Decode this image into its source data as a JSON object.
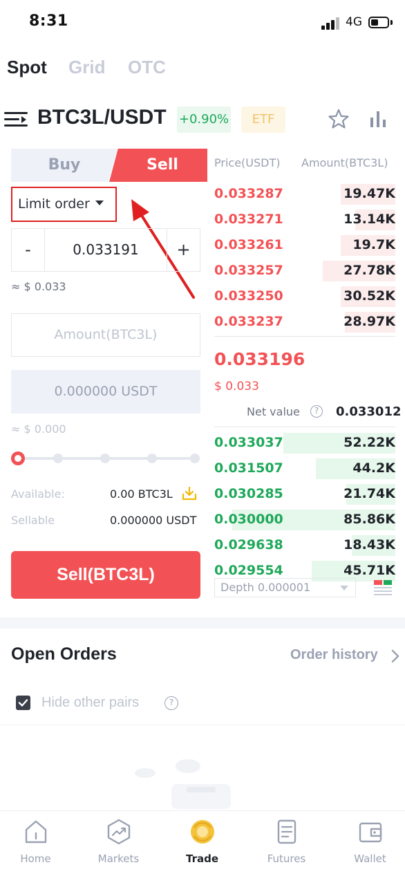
{
  "status_bar": {
    "time": "8:31",
    "network": "4G"
  },
  "mode_tabs": [
    {
      "label": "Spot",
      "active": true
    },
    {
      "label": "Grid",
      "active": false
    },
    {
      "label": "OTC",
      "active": false
    }
  ],
  "pair": {
    "symbol": "BTC3L/USDT",
    "change": "+0.90%",
    "tag": "ETF"
  },
  "order_form": {
    "buy_label": "Buy",
    "sell_label": "Sell",
    "order_type": "Limit order",
    "price_minus": "-",
    "price_value": "0.033191",
    "price_plus": "+",
    "price_approx": "≈ $ 0.033",
    "amount_placeholder": "Amount(BTC3L)",
    "total_value": "0.000000 USDT",
    "total_approx": "≈ $ 0.000",
    "slider_percent": 0,
    "available_label": "Available:",
    "available_value": "0.00 BTC3L",
    "sellable_label": "Sellable",
    "sellable_value": "0.000000 USDT",
    "submit_label": "Sell(BTC3L)"
  },
  "order_book": {
    "price_header": "Price(USDT)",
    "amount_header": "Amount(BTC3L)",
    "asks": [
      {
        "price": "0.033287",
        "amount": "19.47K",
        "depth": 0.3
      },
      {
        "price": "0.033271",
        "amount": "13.14K",
        "depth": 0.22
      },
      {
        "price": "0.033261",
        "amount": "19.7K",
        "depth": 0.3
      },
      {
        "price": "0.033257",
        "amount": "27.78K",
        "depth": 0.4
      },
      {
        "price": "0.033250",
        "amount": "30.52K",
        "depth": 0.3
      },
      {
        "price": "0.033237",
        "amount": "28.97K",
        "depth": 0.28
      }
    ],
    "last_price": "0.033196",
    "last_price_usd": "$ 0.033",
    "net_value_label": "Net value",
    "net_value": "0.033012",
    "bids": [
      {
        "price": "0.033037",
        "amount": "52.22K",
        "depth": 0.62
      },
      {
        "price": "0.031507",
        "amount": "44.2K",
        "depth": 0.44
      },
      {
        "price": "0.030285",
        "amount": "21.74K",
        "depth": 0.27
      },
      {
        "price": "0.030000",
        "amount": "85.86K",
        "depth": 0.9
      },
      {
        "price": "0.029638",
        "amount": "18.43K",
        "depth": 0.24
      },
      {
        "price": "0.029554",
        "amount": "45.71K",
        "depth": 0.46
      }
    ],
    "depth_select": "Depth 0.000001"
  },
  "open_orders": {
    "title": "Open Orders",
    "history_link": "Order history",
    "hide_pairs_label": "Hide other pairs",
    "hide_pairs_checked": true
  },
  "bottom_nav": [
    {
      "label": "Home",
      "icon": "home-icon",
      "active": false
    },
    {
      "label": "Markets",
      "icon": "markets-icon",
      "active": false
    },
    {
      "label": "Trade",
      "icon": "trade-icon",
      "active": true
    },
    {
      "label": "Futures",
      "icon": "futures-icon",
      "active": false
    },
    {
      "label": "Wallet",
      "icon": "wallet-icon",
      "active": false
    }
  ],
  "colors": {
    "sell_red": "#f25255",
    "buy_green": "#1ea85a",
    "highlight_red": "#e02020",
    "trade_gold": "#f5c33b"
  }
}
